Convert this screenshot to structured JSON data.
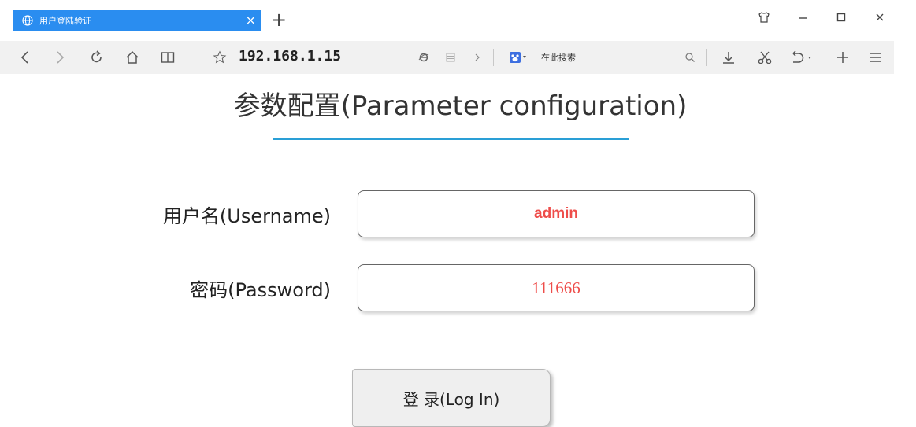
{
  "browser": {
    "tab_title": "用户登陆验证",
    "tab_close": "×",
    "new_tab": "+",
    "window": {
      "skin": "T",
      "minimize": "−",
      "maximize": "☐",
      "close": "×"
    },
    "address": "192.168.1.15",
    "search_placeholder": "在此搜索",
    "accent": "#2a8df0"
  },
  "page": {
    "heading": "参数配置(Parameter configuration)",
    "underline_color": "#2a9fd6",
    "username_label": "用户名(Username)",
    "username_value": "admin",
    "password_label": "密码(Password)",
    "password_value": "111666",
    "value_color": "#ee4d4a",
    "login_button": "登 录(Log In)"
  }
}
